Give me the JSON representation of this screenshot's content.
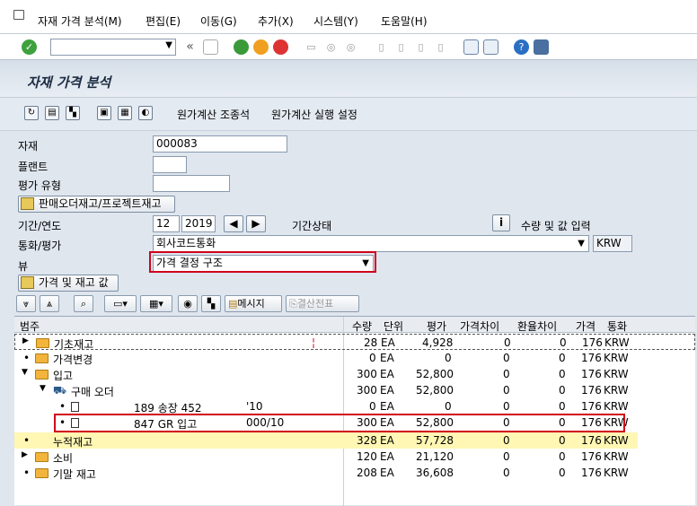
{
  "menu": {
    "items": [
      "자재 가격 분석(M)",
      "편집(E)",
      "이동(G)",
      "추가(X)",
      "시스템(Y)",
      "도움말(H)"
    ]
  },
  "toolbar": {
    "nav_back": "«"
  },
  "title": "자재 가격 분석",
  "app_toolbar": {
    "btn1": "원가계산 조종석",
    "btn2": "원가계산 실행 설정"
  },
  "form": {
    "material_label": "자재",
    "material_value": "000083",
    "plant_label": "플랜트",
    "plant_value": "",
    "valtype_label": "평가 유형",
    "valtype_value": "",
    "sales_order_btn": "판매오더재고/프로젝트재고",
    "period_label": "기간/연도",
    "period_value": "12",
    "year_value": "2019",
    "period_status_label": "기간상태",
    "qty_value_btn": "수량 및 값 입력",
    "currency_label": "통화/평가",
    "currency_value": "회사코드통화",
    "currency_code": "KRW",
    "view_label": "뷰",
    "view_value": "가격 결정 구조",
    "price_stock_btn": "가격 및 재고 값"
  },
  "grid_toolbar": {
    "messages": "메시지",
    "closing_doc": "결산전표"
  },
  "grid": {
    "headers": [
      "범주",
      "수량",
      "단위",
      "평가",
      "가격차이",
      "환율차이",
      "가격",
      "통화"
    ],
    "rows": [
      {
        "label": "기초재고",
        "qty": "28",
        "unit": "EA",
        "val": "4,928",
        "pdiff": "0",
        "xdiff": "0",
        "price": "176",
        "cur": "KRW"
      },
      {
        "label": "가격변경",
        "qty": "0",
        "unit": "EA",
        "val": "0",
        "pdiff": "0",
        "xdiff": "0",
        "price": "176",
        "cur": "KRW"
      },
      {
        "label": "입고",
        "qty": "300",
        "unit": "EA",
        "val": "52,800",
        "pdiff": "0",
        "xdiff": "0",
        "price": "176",
        "cur": "KRW"
      },
      {
        "label": "구매 오더",
        "qty": "300",
        "unit": "EA",
        "val": "52,800",
        "pdiff": "0",
        "xdiff": "0",
        "price": "176",
        "cur": "KRW"
      },
      {
        "label": "189 송장 452",
        "extra": "'10",
        "qty": "0",
        "unit": "EA",
        "val": "0",
        "pdiff": "0",
        "xdiff": "0",
        "price": "176",
        "cur": "KRW"
      },
      {
        "label": "847 GR 입고",
        "extra": "000/10",
        "qty": "300",
        "unit": "EA",
        "val": "52,800",
        "pdiff": "0",
        "xdiff": "0",
        "price": "176",
        "cur": "KRW"
      },
      {
        "label": "누적재고",
        "qty": "328",
        "unit": "EA",
        "val": "57,728",
        "pdiff": "0",
        "xdiff": "0",
        "price": "176",
        "cur": "KRW"
      },
      {
        "label": "소비",
        "qty": "120",
        "unit": "EA",
        "val": "21,120",
        "pdiff": "0",
        "xdiff": "0",
        "price": "176",
        "cur": "KRW"
      },
      {
        "label": "기말 재고",
        "qty": "208",
        "unit": "EA",
        "val": "36,608",
        "pdiff": "0",
        "xdiff": "0",
        "price": "176",
        "cur": "KRW"
      }
    ]
  },
  "colors": {
    "highlight_red": "#d0021b",
    "cumulative_row": "#fff7b3"
  }
}
